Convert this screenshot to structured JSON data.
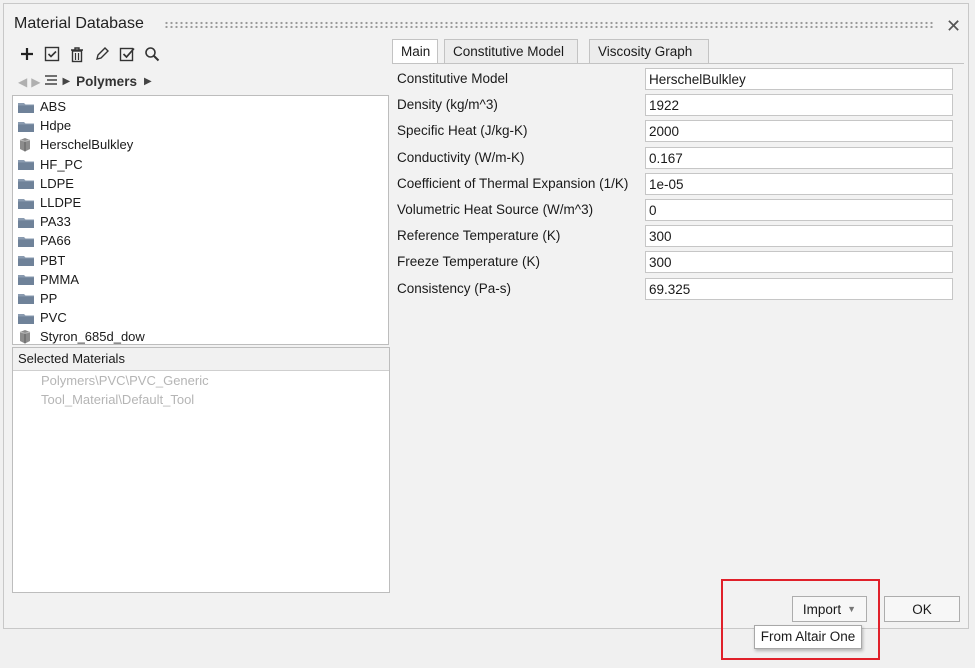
{
  "window": {
    "title": "Material Database"
  },
  "breadcrumb": {
    "current": "Polymers"
  },
  "toolbar": {
    "icons": [
      "add-icon",
      "check-box-icon",
      "delete-icon",
      "edit-icon",
      "validate-icon",
      "search-icon"
    ]
  },
  "tree": {
    "items": [
      {
        "label": "ABS",
        "icon": "folder"
      },
      {
        "label": "Hdpe",
        "icon": "folder"
      },
      {
        "label": "HerschelBulkley",
        "icon": "material-cube"
      },
      {
        "label": "HF_PC",
        "icon": "folder"
      },
      {
        "label": "LDPE",
        "icon": "folder"
      },
      {
        "label": "LLDPE",
        "icon": "folder"
      },
      {
        "label": "PA33",
        "icon": "folder"
      },
      {
        "label": "PA66",
        "icon": "folder"
      },
      {
        "label": "PBT",
        "icon": "folder"
      },
      {
        "label": "PMMA",
        "icon": "folder"
      },
      {
        "label": "PP",
        "icon": "folder"
      },
      {
        "label": "PVC",
        "icon": "folder"
      },
      {
        "label": "Styron_685d_dow",
        "icon": "material-cube"
      }
    ]
  },
  "selected": {
    "header": "Selected Materials",
    "items": [
      "Polymers\\PVC\\PVC_Generic",
      "Tool_Material\\Default_Tool"
    ]
  },
  "tabs": [
    "Main",
    "Constitutive Model",
    "Viscosity Graph"
  ],
  "properties": [
    {
      "label": "Constitutive Model",
      "value": "HerschelBulkley"
    },
    {
      "label": "Density (kg/m^3)",
      "value": "1922"
    },
    {
      "label": "Specific Heat (J/kg-K)",
      "value": "2000"
    },
    {
      "label": "Conductivity (W/m-K)",
      "value": "0.167"
    },
    {
      "label": "Coefficient of Thermal Expansion (1/K)",
      "value": "1e-05"
    },
    {
      "label": "Volumetric Heat Source (W/m^3)",
      "value": " 0"
    },
    {
      "label": "Reference Temperature (K)",
      "value": "300"
    },
    {
      "label": "Freeze Temperature (K)",
      "value": "300"
    },
    {
      "label": "Consistency (Pa-s)",
      "value": "69.325"
    }
  ],
  "buttons": {
    "import": "Import",
    "ok": "OK",
    "import_menu_item": "From Altair One"
  },
  "colors": {
    "highlight": "#e0202a",
    "folder": "#7f93ab"
  }
}
